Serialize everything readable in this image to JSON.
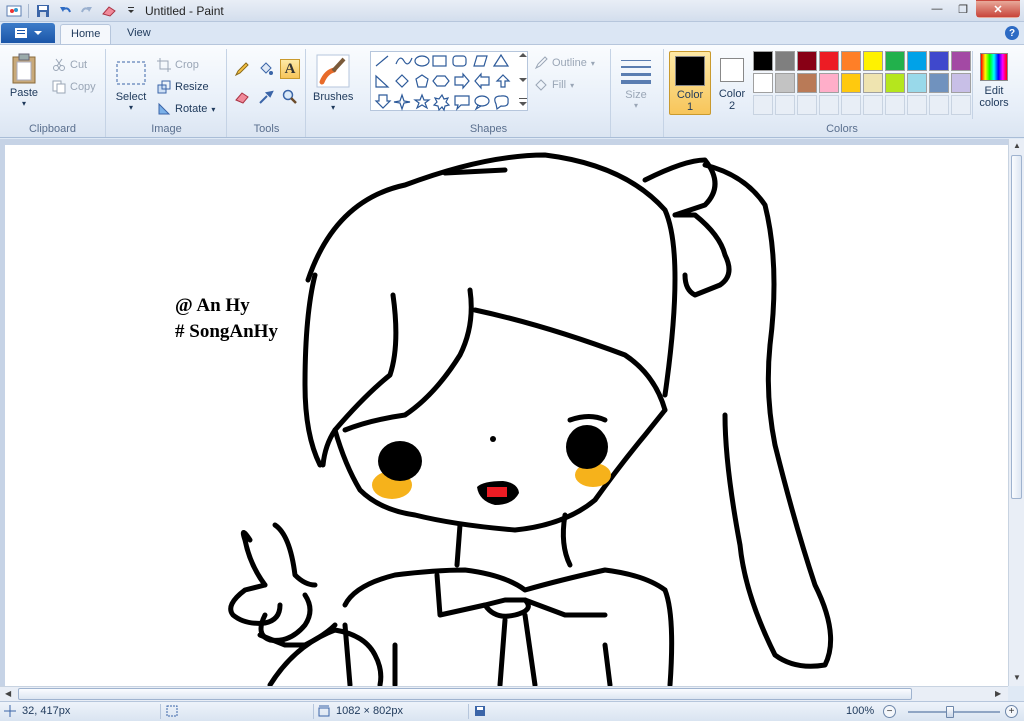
{
  "window": {
    "title": "Untitled - Paint"
  },
  "tabs": [
    {
      "label": "Home"
    },
    {
      "label": "View"
    }
  ],
  "clipboard": {
    "paste": "Paste",
    "cut": "Cut",
    "copy": "Copy",
    "label": "Clipboard"
  },
  "image": {
    "select": "Select",
    "crop": "Crop",
    "resize": "Resize",
    "rotate": "Rotate",
    "label": "Image"
  },
  "tools": {
    "label": "Tools"
  },
  "brushes": {
    "label": "Brushes"
  },
  "shapes": {
    "outline": "Outline",
    "fill": "Fill",
    "label": "Shapes"
  },
  "size": {
    "label": "Size"
  },
  "colors": {
    "color1_label": "Color",
    "color1_num": "1",
    "color2_label": "Color",
    "color2_num": "2",
    "edit_label_1": "Edit",
    "edit_label_2": "colors",
    "label": "Colors",
    "color1_value": "#000000",
    "color2_value": "#ffffff",
    "palette": [
      "#000000",
      "#7f7f7f",
      "#880015",
      "#ed1c24",
      "#ff7f27",
      "#fff200",
      "#22b14c",
      "#00a2e8",
      "#3f48cc",
      "#a349a4",
      "#ffffff",
      "#c3c3c3",
      "#b97a57",
      "#ffaec9",
      "#ffc90e",
      "#efe4b0",
      "#b5e61d",
      "#99d9ea",
      "#7092be",
      "#c8bfe7"
    ]
  },
  "canvas": {
    "watermark_line1": "@ An Hy",
    "watermark_line2": "# SongAnHy"
  },
  "status": {
    "cursor_pos": "32, 417px",
    "image_size": "1082 × 802px",
    "zoom": "100%"
  }
}
